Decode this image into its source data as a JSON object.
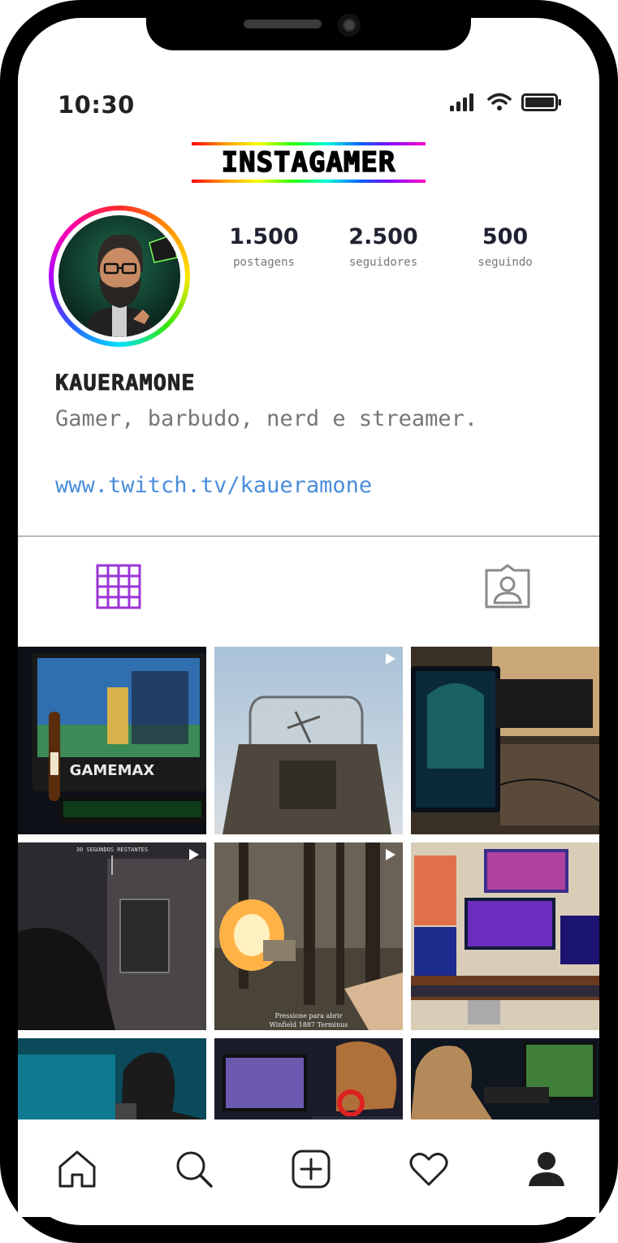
{
  "status_bar": {
    "time": "10:30"
  },
  "app": {
    "logo_text": "INSTAGAMER",
    "accent_color": "#9b34d6",
    "link_color": "#4a8edc"
  },
  "profile": {
    "stats": [
      {
        "value": "1.500",
        "label": "postagens"
      },
      {
        "value": "2.500",
        "label": "seguidores"
      },
      {
        "value": "500",
        "label": "seguindo"
      }
    ],
    "username": "KAUERAMONE",
    "bio": "Gamer, barbudo, nerd e streamer.",
    "link": "www.twitch.tv/kaueramone"
  },
  "tabs": [
    {
      "icon": "grid-icon",
      "active": true
    },
    {
      "icon": "tagged-person-icon",
      "active": false
    }
  ],
  "posts": [
    {
      "type": "photo",
      "game_text": "GAMEMAX"
    },
    {
      "type": "video"
    },
    {
      "type": "photo"
    },
    {
      "type": "video",
      "hud_text": "30 SEGUNDOS RESTANTES"
    },
    {
      "type": "video",
      "caption_line1": "Pressione    para abrir",
      "caption_line2": "Winfield 1887 Terminus"
    },
    {
      "type": "photo"
    },
    {
      "type": "photo"
    },
    {
      "type": "photo"
    },
    {
      "type": "photo"
    }
  ],
  "bottom_nav": [
    {
      "icon": "home-icon"
    },
    {
      "icon": "search-icon"
    },
    {
      "icon": "add-post-icon"
    },
    {
      "icon": "heart-icon"
    },
    {
      "icon": "profile-icon"
    }
  ]
}
